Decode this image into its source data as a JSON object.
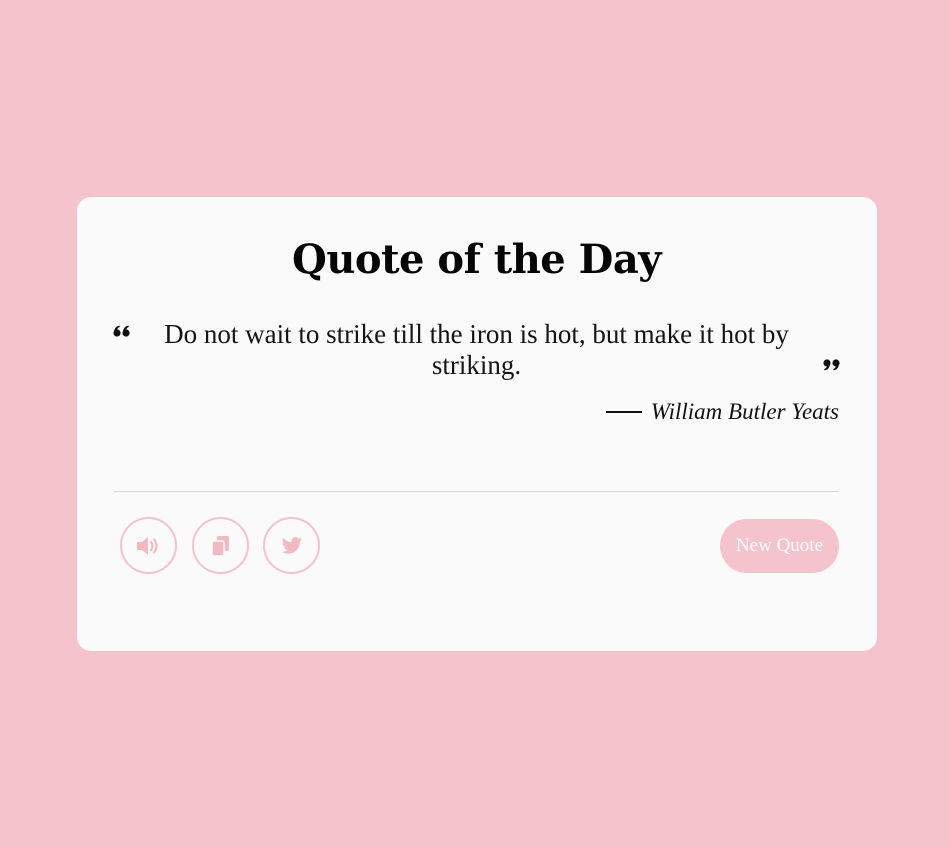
{
  "card": {
    "title": "Quote of the Day",
    "quote": "Do not wait to strike till the iron is hot, but make it hot by striking.",
    "author": "William Butler Yeats"
  },
  "icons": {
    "open_quote": "quote-left-icon",
    "close_quote": "quote-right-icon",
    "speech": "volume-icon",
    "copy": "copy-icon",
    "twitter": "twitter-icon"
  },
  "controls": {
    "new_quote_label": "New Quote"
  },
  "colors": {
    "background": "#f5c3cb",
    "card": "#fbfafa",
    "accent": "#f4c2ca",
    "text": "#141414"
  }
}
